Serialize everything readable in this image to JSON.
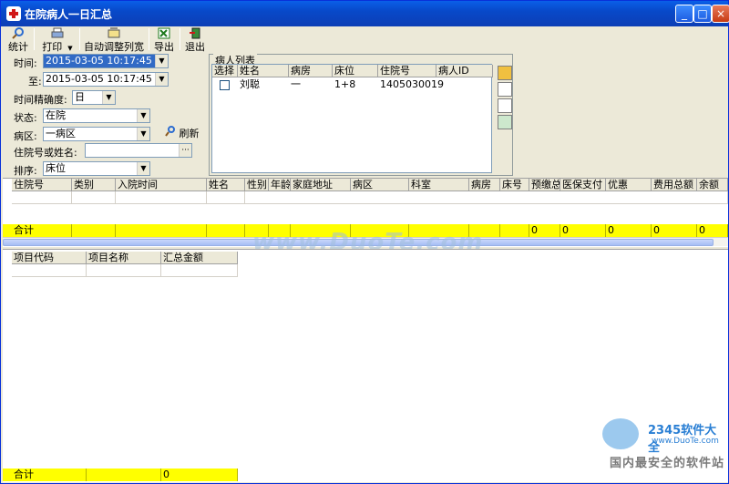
{
  "window": {
    "title": "在院病人一日汇总",
    "min": "_",
    "max": "□",
    "close": "×"
  },
  "toolbar": [
    {
      "label": "统计",
      "icon": "magnifier-icon"
    },
    {
      "label": "打印",
      "icon": "printer-icon"
    },
    {
      "label": "自动调整列宽",
      "icon": "autofit-icon"
    },
    {
      "label": "导出",
      "icon": "excel-icon"
    },
    {
      "label": "退出",
      "icon": "exit-icon"
    }
  ],
  "filters": {
    "time_label": "时间:",
    "time_from": "2015-03-05 10:17:45",
    "to_label": "至:",
    "time_to": "2015-03-05 10:17:45",
    "precision_label": "时间精确度:",
    "precision": "日",
    "status_label": "状态:",
    "status": "在院",
    "ward_label": "病区:",
    "ward": "一病区",
    "refresh": "刷新",
    "search_label": "住院号或姓名:",
    "search_value": "",
    "sort_label": "排序:",
    "sort": "床位"
  },
  "patient_list": {
    "caption": "病人列表",
    "columns": [
      "选择",
      "姓名",
      "病房",
      "床位",
      "住院号",
      "病人ID"
    ],
    "rows": [
      {
        "check": "",
        "name": "刘聪",
        "room": "一",
        "bed": "1+8",
        "inpatient_no": "1405030019",
        "pid": ""
      }
    ]
  },
  "main_grid": {
    "columns": [
      "住院号",
      "类别",
      "入院时间",
      "姓名",
      "性别",
      "年龄",
      "家庭地址",
      "病区",
      "科室",
      "病房",
      "床号",
      "预缴总额",
      "医保支付",
      "优惠",
      "费用总额",
      "余额"
    ],
    "total_label": "合计",
    "totals": {
      "prepay": "0",
      "insurance": "0",
      "discount": "0",
      "total_fee": "0",
      "balance": "0"
    }
  },
  "sub_grid": {
    "columns": [
      "项目代码",
      "项目名称",
      "汇总金额"
    ],
    "total_label": "合计",
    "total_amount": "0"
  },
  "watermark": {
    "text": "www.DuoTe.com",
    "brand": "2345软件大全",
    "url": "www.DuoTe.com",
    "slogan": "国内最安全的软件站"
  },
  "colors": {
    "title_bar": "#0A5FE8",
    "total_row": "#FFFF00",
    "selection": "#316AC5"
  }
}
